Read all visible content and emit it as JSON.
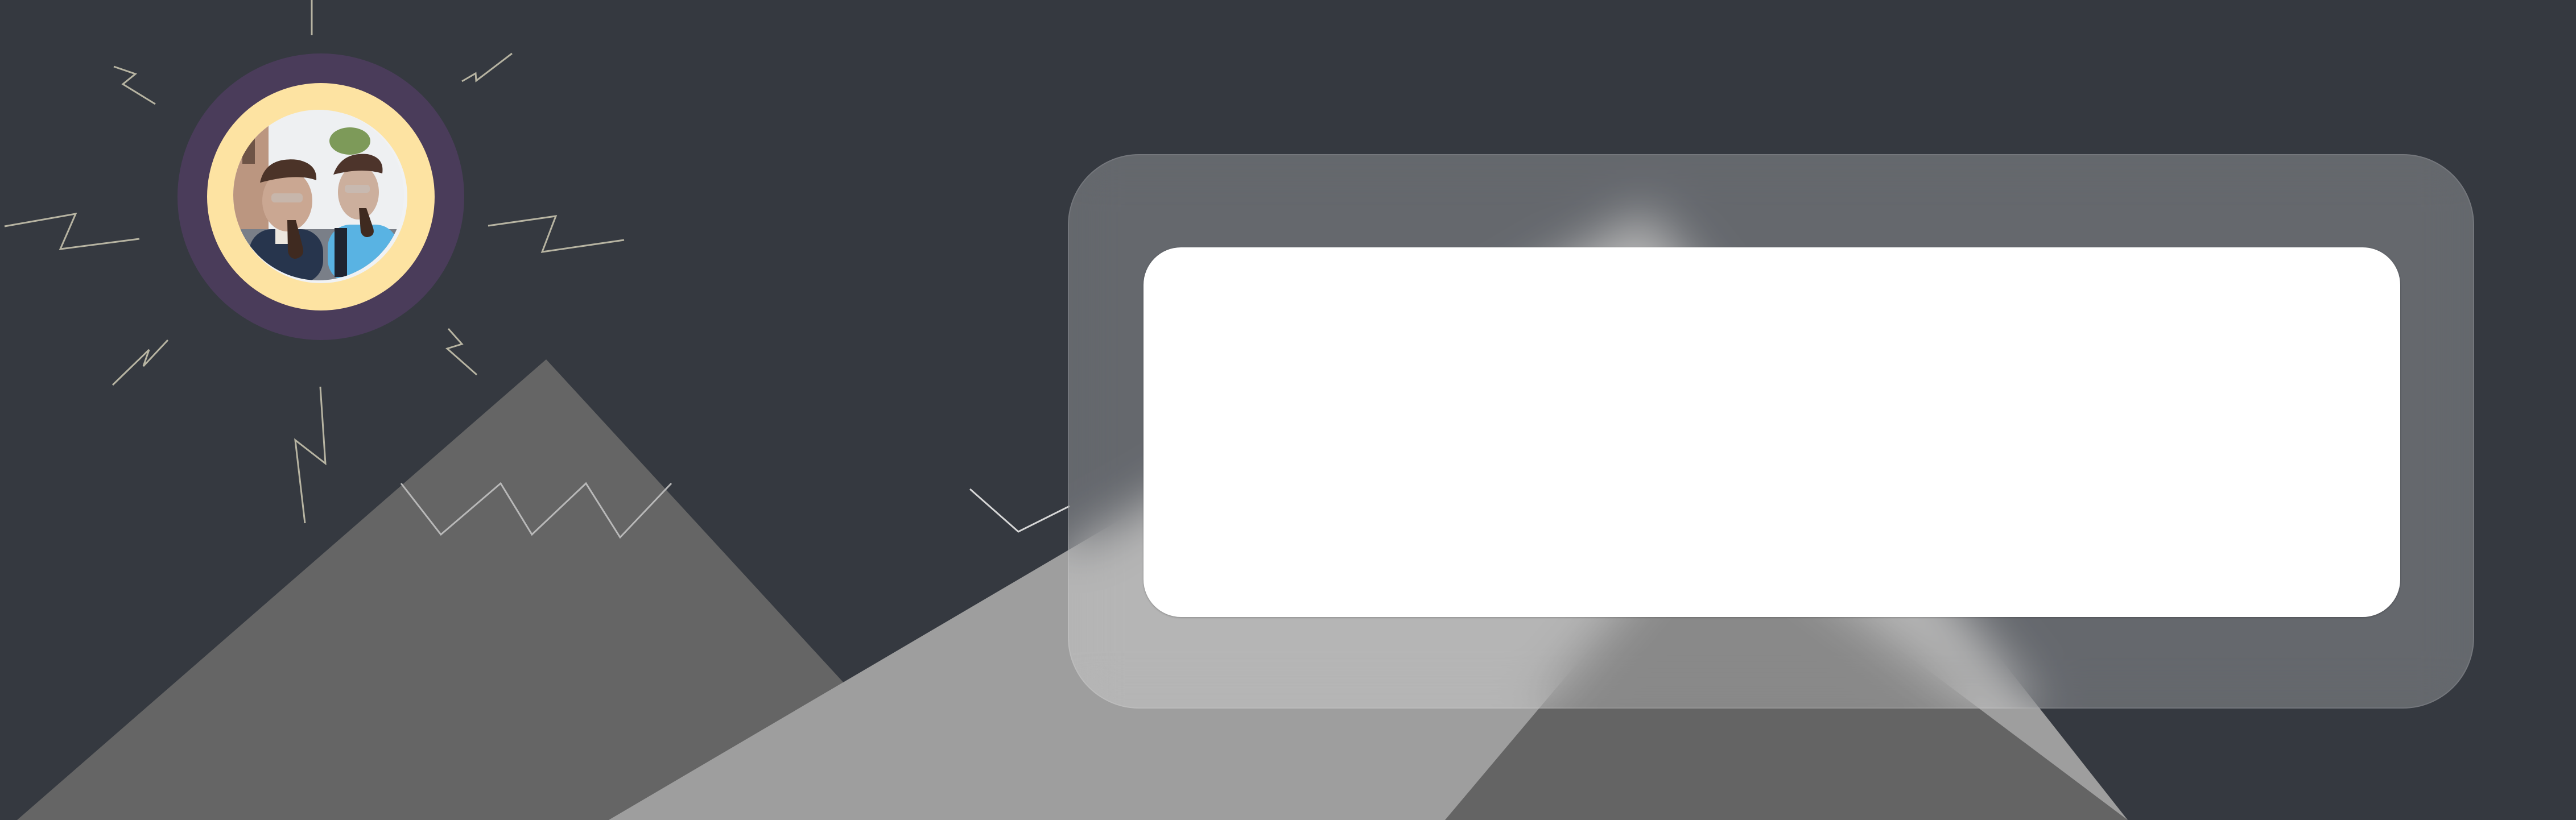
{
  "colors": {
    "background": "#353940",
    "mountain_dark": "#656565",
    "mountain_light": "#9e9e9e",
    "avatar_ring_outer": "#4a3c5a",
    "avatar_ring_inner": "#fde3a2",
    "card": "#ffffff",
    "panel": "#5d6168",
    "decor_line": "#b7b4a2"
  },
  "illustration": {
    "subject": "two-people-with-pipes-photo",
    "decor": "sun-rays"
  },
  "card": {
    "content": ""
  }
}
